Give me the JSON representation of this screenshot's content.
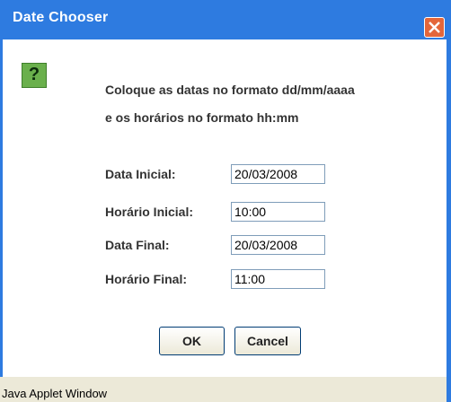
{
  "window": {
    "title": "Date Chooser"
  },
  "message": {
    "line1": "Coloque as datas no formato dd/mm/aaaa",
    "line2": "e os horários no formato hh:mm"
  },
  "fields": [
    {
      "label": "Data Inicial:",
      "value": "20/03/2008"
    },
    {
      "label": "Horário Inicial:",
      "value": "10:00"
    },
    {
      "label": "Data Final:",
      "value": "20/03/2008"
    },
    {
      "label": "Horário Final:",
      "value": "11:00"
    }
  ],
  "buttons": {
    "ok": "OK",
    "cancel": "Cancel"
  },
  "status": {
    "text": "Java Applet Window"
  },
  "icons": {
    "dialog": "question-icon",
    "close": "close-icon"
  },
  "colors": {
    "titlebar": "#2e7be0",
    "close": "#e4663a",
    "icon": "#6ab04c",
    "status_bar": "#ece9d8"
  }
}
